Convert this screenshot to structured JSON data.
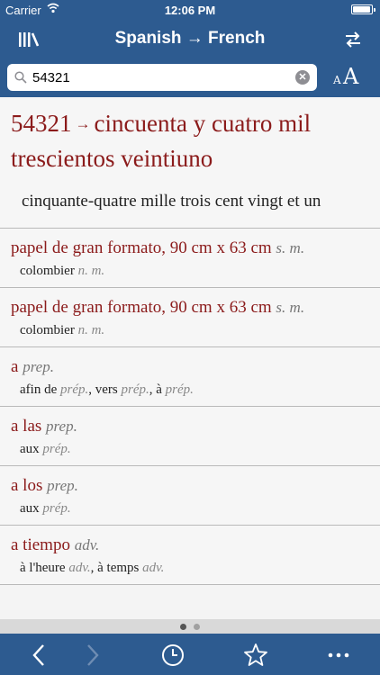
{
  "status": {
    "carrier": "Carrier",
    "time": "12:06 PM"
  },
  "nav": {
    "title": "Spanish → French"
  },
  "search": {
    "value": "54321"
  },
  "font_btn": {
    "small": "A",
    "big": "A"
  },
  "main_entry": {
    "headword": "54321",
    "arrow": "→",
    "spelled": "cincuenta y cuatro mil trescientos veintiuno",
    "translation": "cinquante-quatre mille trois cent vingt et un"
  },
  "entries": [
    {
      "headword": "papel de gran formato, 90 cm x 63 cm",
      "pos": "s. m.",
      "translation": [
        {
          "t": "colombier",
          "g": "n. m."
        }
      ]
    },
    {
      "headword": "papel de gran formato, 90 cm x 63 cm",
      "pos": "s. m.",
      "translation": [
        {
          "t": "colombier",
          "g": "n. m."
        }
      ]
    },
    {
      "headword": "a",
      "pos": "prep.",
      "translation": [
        {
          "t": "afin de",
          "g": "prép."
        },
        {
          "t": "vers",
          "g": "prép."
        },
        {
          "t": "à",
          "g": "prép."
        }
      ]
    },
    {
      "headword": "a las",
      "pos": "prep.",
      "translation": [
        {
          "t": "aux",
          "g": "prép."
        }
      ]
    },
    {
      "headword": "a los",
      "pos": "prep.",
      "translation": [
        {
          "t": "aux",
          "g": "prép."
        }
      ]
    },
    {
      "headword": "a tiempo",
      "pos": "adv.",
      "translation": [
        {
          "t": "à l'heure",
          "g": "adv."
        },
        {
          "t": "à temps",
          "g": "adv."
        }
      ]
    }
  ],
  "pager": {
    "pages": 2,
    "current": 1
  },
  "toolbar": {
    "icons": [
      "back-icon",
      "forward-icon",
      "history-icon",
      "star-icon",
      "more-icon"
    ]
  },
  "colors": {
    "bar": "#2d5b90",
    "headword": "#8b1b1b",
    "grammar": "#777777"
  }
}
